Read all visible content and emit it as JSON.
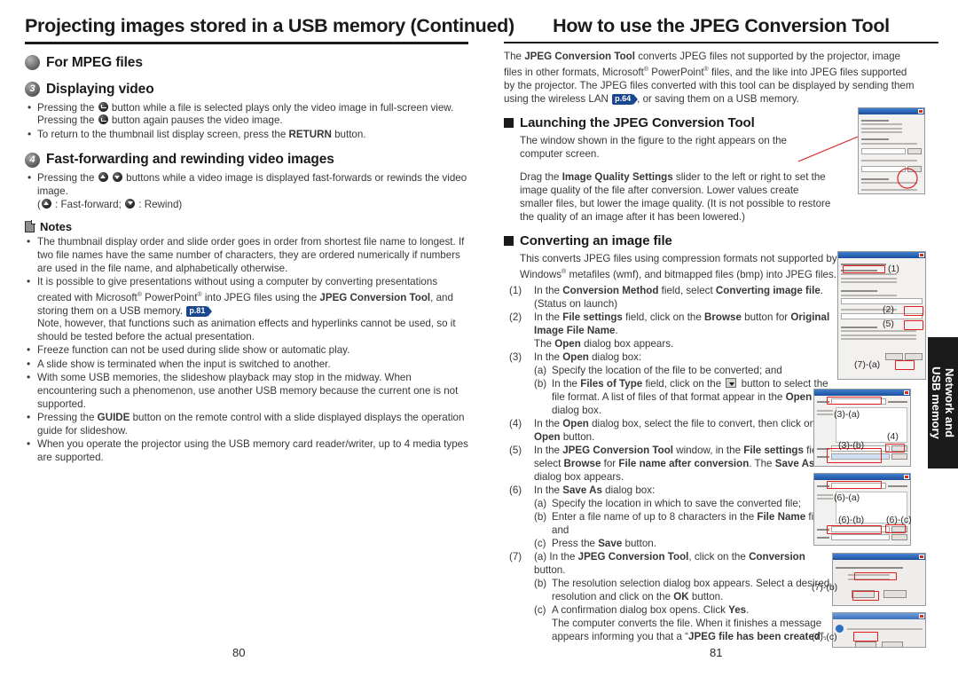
{
  "left_page": {
    "number": "80",
    "chapter_title": "Projecting images stored in a USB memory (Continued)",
    "section_mpeg": "For MPEG files",
    "step3": {
      "num": "3",
      "title": "Displaying video"
    },
    "step3_bullets": [
      "Pressing the ● button while a file is selected plays only the video image in full-screen view. Pressing the ● button again pauses the video image.",
      "To return to the thumbnail list display screen, press the RETURN button."
    ],
    "step4": {
      "num": "4",
      "title": "Fast-forwarding and rewinding video images"
    },
    "step4_bullet": "Pressing the ▲ ▼ buttons while a video image is displayed fast-forwards or rewinds the video image.",
    "step4_legend": "( ▲ : Fast-forward; ▼ : Rewind)",
    "notes_label": "Notes",
    "notes": [
      "The thumbnail display order and slide order goes in order from shortest file name to longest. If two file names have the same number of characters, they are ordered numerically if numbers are used in the file name, and alphabetically otherwise.",
      "It is possible to give presentations without using a computer by converting presentations created with Microsoft® PowerPoint® into JPEG files using the JPEG Conversion Tool, and storing them on a USB memory. p.81 Note, however, that functions such as animation effects and hyperlinks cannot be used, so it should be tested before the actual presentation.",
      "Freeze function can not be used during slide show or automatic play.",
      "A slide show is terminated when the input is switched to another.",
      "With some USB memories, the slideshow playback may stop in the midway. When encountering such a phenomenon, use another USB memory because the current one is not supported.",
      "Pressing the GUIDE button on the remote control with a slide displayed displays the operation guide for slideshow.",
      "When you operate the projector using the USB memory card reader/writer, up to 4 media types are supported."
    ],
    "page_ref_81": "p.81"
  },
  "right_page": {
    "number": "81",
    "title": "How to use the JPEG Conversion Tool",
    "intro_part1": "The ",
    "intro_bold1": "JPEG Conversion Tool",
    "intro_part2": " converts JPEG files not supported by the projector, image files in other formats, Microsoft",
    "intro_part3": " PowerPoint",
    "intro_part4": " files, and the like into JPEG files supported by the projector. The JPEG files converted with this tool can be displayed by sending them using the wireless LAN ",
    "page_ref_64": "p.64",
    "intro_part5": ", or saving them on a USB memory.",
    "section_launch": "Launching the JPEG Conversion Tool",
    "launch_para1": "The window shown in the figure to the right appears on the computer screen.",
    "launch_para2_a": "Drag the ",
    "launch_para2_bold": "Image Quality Settings",
    "launch_para2_b": " slider to the left or right to set the image quality of the file after conversion. Lower values create smaller files, but lower the image quality. (It is not possible to restore the quality of an image after it has been lowered.)",
    "section_convert": "Converting an image file",
    "convert_intro_a": "This converts JPEG files using compression formats not supported by the projector, Windows",
    "convert_intro_b": " metafiles (wmf), and bitmapped files (bmp) into JPEG files.",
    "steps": [
      {
        "num": "(1)",
        "parts": [
          "In the ",
          "Conversion Method",
          " field, select ",
          "Converting image file",
          ". (Status on launch)"
        ]
      },
      {
        "num": "(2)",
        "parts": [
          "In the ",
          "File settings",
          " field, click on the ",
          "Browse",
          " button for ",
          "Original Image File Name",
          "."
        ]
      },
      {
        "num": "",
        "parts": [
          "The ",
          "Open",
          " dialog box appears."
        ]
      },
      {
        "num": "(3)",
        "parts": [
          "In the ",
          "Open",
          " dialog box:"
        ]
      },
      {
        "num": "(a)",
        "parts": [
          "Specify the location of the file to be converted; and"
        ]
      },
      {
        "num": "(b)",
        "parts": [
          "In the ",
          "Files of Type",
          " field, click on the ▼ button to select the file format. A list of files of that format appear in the ",
          "Open",
          " dialog box."
        ]
      },
      {
        "num": "(4)",
        "parts": [
          "In the ",
          "Open",
          " dialog box, select the file to convert, then click on the ",
          "Open",
          " button."
        ]
      },
      {
        "num": "(5)",
        "parts": [
          "In the ",
          "JPEG Conversion Tool",
          " window, in the ",
          "File settings",
          " field, select ",
          "Browse",
          " for ",
          "File name after conversion",
          ". The ",
          "Save As",
          " dialog box appears."
        ]
      },
      {
        "num": "(6)",
        "parts": [
          "In the ",
          "Save As",
          " dialog box:"
        ]
      },
      {
        "num": "(a)",
        "parts": [
          "Specify the location in which to save the converted file;"
        ]
      },
      {
        "num": "(b)",
        "parts": [
          "Enter a file name of up to 8 characters in the ",
          "File Name",
          " field; and"
        ]
      },
      {
        "num": "(c)",
        "parts": [
          "Press the ",
          "Save",
          " button."
        ]
      },
      {
        "num": "(7)",
        "parts": [
          "(a) In the ",
          "JPEG Conversion Tool",
          ", click on the ",
          "Conversion",
          " button."
        ]
      },
      {
        "num": "(b)",
        "parts": [
          "The resolution selection dialog box appears. Select a desired resolution and click on the ",
          "OK",
          " button."
        ]
      },
      {
        "num": "(c)",
        "parts": [
          "A confirmation dialog box opens. Click ",
          "Yes",
          ". The computer converts the file. When it finishes a message  appears informing you that a “",
          "JPEG file has been created",
          "”."
        ]
      }
    ],
    "figure_callouts": {
      "f2_1": "(1)",
      "f2_2": "(2)",
      "f2_5": "(5)",
      "f2_7a": "(7)-(a)",
      "f3_3a": "(3)-(a)",
      "f3_3b": "(3)-(b)",
      "f3_4": "(4)",
      "f4_6a": "(6)-(a)",
      "f4_6b": "(6)-(b)",
      "f4_6c": "(6)-(c)",
      "f5_7b": "(7)-(b)",
      "f6_7c": "(7)-(c)"
    }
  },
  "side_tab": {
    "line1": "Network and",
    "line2": "USB memory"
  },
  "colors": {
    "ref_badge": "#18478f",
    "rule": "#1a1a1a",
    "red_highlight": "#e02020",
    "tab_bg": "#1a1a1a"
  }
}
